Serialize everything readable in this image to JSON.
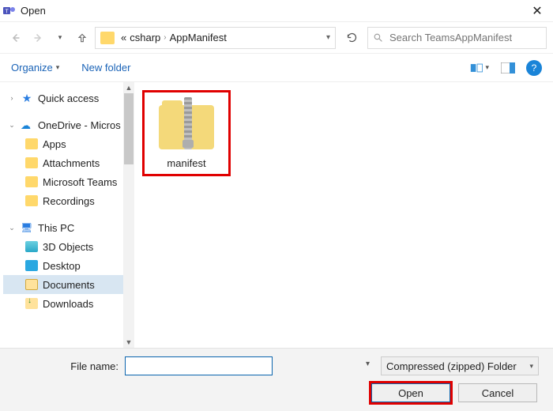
{
  "title": "Open",
  "breadcrumb": {
    "prefix": "«",
    "parts": [
      "csharp",
      "AppManifest"
    ]
  },
  "search": {
    "placeholder": "Search TeamsAppManifest"
  },
  "toolbar": {
    "organize": "Organize",
    "new_folder": "New folder"
  },
  "tree": {
    "quick_access": "Quick access",
    "onedrive": "OneDrive - Micros",
    "onedrive_children": [
      "Apps",
      "Attachments",
      "Microsoft Teams",
      "Recordings"
    ],
    "this_pc": "This PC",
    "this_pc_children": [
      "3D Objects",
      "Desktop",
      "Documents",
      "Downloads"
    ]
  },
  "selected_tree_item": "Documents",
  "files": [
    {
      "name": "manifest",
      "kind": "zip"
    }
  ],
  "filename_label": "File name:",
  "filename_value": "",
  "filter": "Compressed (zipped) Folder",
  "buttons": {
    "open": "Open",
    "cancel": "Cancel"
  }
}
